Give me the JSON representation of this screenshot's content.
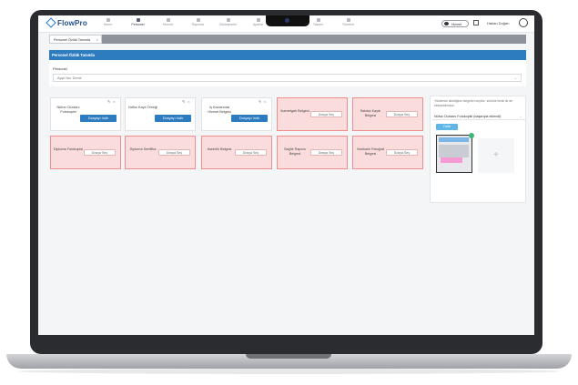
{
  "app": {
    "logo_text": "FlowPro"
  },
  "nav": {
    "items": [
      {
        "label": "Home"
      },
      {
        "label": "Personel",
        "active": true
      },
      {
        "label": "Hizmet"
      },
      {
        "label": "Raporlar"
      },
      {
        "label": "Sözleşmeler"
      },
      {
        "label": "Ayarlar"
      },
      {
        "label": "Görevler"
      },
      {
        "label": "Takvim"
      },
      {
        "label": "Yönetim"
      }
    ]
  },
  "header": {
    "toggle_label": "Hizmet",
    "user_name": "Hakan Doğan"
  },
  "tab": {
    "label": "Personel Özlük Tanımla",
    "close": "×"
  },
  "panel": {
    "title": "Personel Özlük Tanımla",
    "field_label": "Personel",
    "field_value": "Ayşe Nur Demir",
    "chevron": "⌄"
  },
  "docs": [
    {
      "label": "Nüfus Cüzdanı Fotokopisi",
      "action": "Dosyayı İndir",
      "state": "uploaded"
    },
    {
      "label": "Nüfus Kayıt Örneği",
      "action": "Dosyayı İndir",
      "state": "uploaded"
    },
    {
      "label": "İş Kazasında Hizmet Belgesi",
      "action": "Dosyayı İndir",
      "state": "uploaded"
    },
    {
      "label": "İkametgah Belgesi",
      "action": "Dosya Seç",
      "state": "required"
    },
    {
      "label": "Sabıka Kaydı Belgesi",
      "action": "Dosya Seç",
      "state": "required"
    },
    {
      "label": "Diploma Fotokopisi",
      "action": "Dosya Seç",
      "state": "required"
    },
    {
      "label": "Diploma Sertifika",
      "action": "Dosya Seç",
      "state": "required"
    },
    {
      "label": "Askerlik Belgesi",
      "action": "Dosya Seç",
      "state": "required"
    },
    {
      "label": "Sağlık Raporu Belgesi",
      "action": "Dosya Seç",
      "state": "required"
    },
    {
      "label": "Vesikalık Fotoğraf Belgesi",
      "action": "Dosya Seç",
      "state": "required"
    }
  ],
  "right_pane": {
    "info_text": "Yüklemek istediğiniz belgeleri seçiniz, sürükle bırak ile de ekleyebilirsiniz.",
    "select_value": "Nüfus Cüzdanı Fotokopisi (başarıyla eklendi)",
    "button_label": "Yükle",
    "add_symbol": "+"
  },
  "colors": {
    "accent": "#2e7cc0",
    "required_bg": "#fbdcdc",
    "required_border": "#ef8c8c"
  }
}
